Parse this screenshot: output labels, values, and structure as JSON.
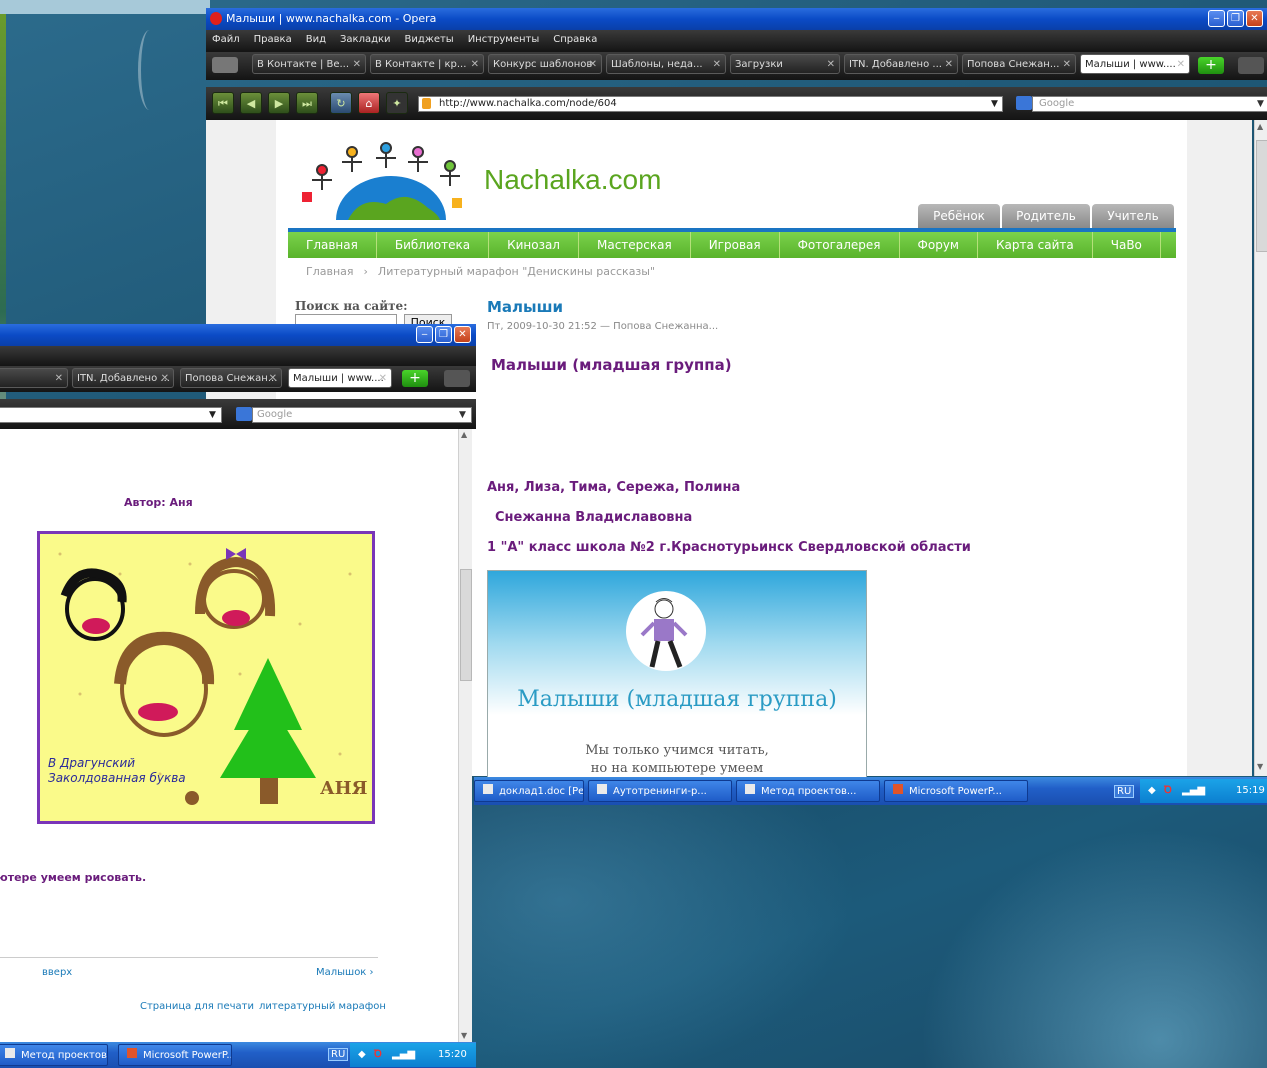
{
  "main_window": {
    "title": "Малыши | www.nachalka.com - Opera",
    "menu": [
      "Файл",
      "Правка",
      "Вид",
      "Закладки",
      "Виджеты",
      "Инструменты",
      "Справка"
    ],
    "tabs": [
      "В Контакте | Ве...",
      "В Контакте | кр...",
      "Конкурс шаблонов",
      "Шаблоны, неда...",
      "Загрузки",
      "ITN. Добавлено ...",
      "Попова Снежан...",
      "Малыши | www...."
    ],
    "address": "http://www.nachalka.com/node/604",
    "search_placeholder": "Google"
  },
  "site": {
    "logo": "Nachalka.com",
    "user_tabs": [
      "Ребёнок",
      "Родитель",
      "Учитель"
    ],
    "nav": [
      "Главная",
      "Библиотека",
      "Кинозал",
      "Мастерская",
      "Игровая",
      "Фотогалерея",
      "Форум",
      "Карта сайта",
      "ЧаВо"
    ],
    "breadcrumb": [
      "Главная",
      "›",
      "Литературный марафон \"Денискины рассказы\""
    ],
    "search_label": "Поиск на сайте:",
    "search_button": "Поиск"
  },
  "article": {
    "title": "Малыши",
    "meta": "Пт, 2009-10-30 21:52 — Попова Снежанна...",
    "heading": "Малыши (младшая группа)",
    "names": "Аня, Лиза, Тима, Сережа, Полина",
    "teacher": "Снежанна Владиславовна",
    "school": "1 \"А\" класс школа №2 г.Краснотурьинск Свердловской области",
    "slide_title": "Малыши (младшая группа)",
    "slide_line1": "Мы только учимся читать,",
    "slide_line2": "но на компьютере умеем"
  },
  "main_taskbar": {
    "tasks": [
      "доклад1.doc [Ре...",
      "Аутотренинги-р...",
      "Метод проектов...",
      "Microsoft PowerP..."
    ],
    "lang": "RU",
    "time": "15:19"
  },
  "second_window": {
    "tabs": [
      "ITN. Добавлено ...",
      "Попова Снежан...",
      "Малыши | www...."
    ],
    "search_placeholder": "Google",
    "author": "Автор: Аня",
    "drawing_caption_line1": "В Драгунский",
    "drawing_caption_line2": "Заколдованная буква",
    "drawing_signature": "АНЯ",
    "text_fragment": "ютере умеем рисовать.",
    "link_up": "вверх",
    "link_next": "Малышок ›",
    "link_print": "Страница для печати",
    "link_marathon": "литературный марафон"
  },
  "second_taskbar": {
    "tasks": [
      "Метод проектов...",
      "Microsoft PowerP..."
    ],
    "lang": "RU",
    "time": "15:20"
  },
  "colors": {
    "nav_green": "#6cc243",
    "logo_green": "#5aa51f",
    "article_blue": "#1a7ab8",
    "accent_purple": "#6a1c7c",
    "title_blue": "#0b4bc6"
  }
}
